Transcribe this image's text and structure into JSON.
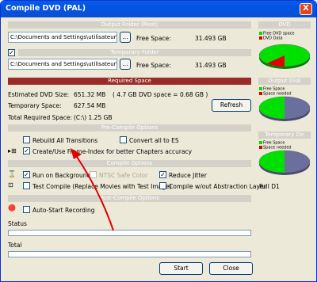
{
  "window": {
    "title": "Compile DVD (PAL)",
    "close_glyph": "X"
  },
  "output_folder": {
    "header": "Output Folder (Root)",
    "path": "C:\\Documents and Settings\\utilisateur\\Bur",
    "browse": "...",
    "free_label": "Free Space:",
    "free_value": "31.493 GB"
  },
  "temp_folder": {
    "header": "Temporary Folder",
    "checked": "✓",
    "path": "C:\\Documents and Settings\\utilisateur\\Bur",
    "browse": "...",
    "free_label": "Free Space:",
    "free_value": "31.493 GB"
  },
  "required": {
    "header": "Required Space",
    "dvd_label": "Estimated DVD Size:",
    "dvd_value": "651.32 MB",
    "dvd_note": "( 4.7 GB DVD space = 0.68 GB )",
    "temp_label": "Temporary Space:",
    "temp_value": "627.54 MB",
    "total_label": "Total Required Space:",
    "total_value": "(C:\\) 1.25 GB",
    "refresh": "Refresh"
  },
  "precompile": {
    "header": "Pre-Compile Options",
    "rebuild": "Rebuild All Transitions",
    "convert": "Convert all to ES",
    "frame_index": "Create/Use Frame-Index for better Chapters accuracy",
    "frame_index_checked": "✓"
  },
  "compile": {
    "header": "Compile Options",
    "background": "Run on Background",
    "background_checked": "✓",
    "ntsc": "NTSC Safe Color",
    "jitter": "Reduce Jitter",
    "jitter_checked": "✓",
    "test": "Test Compile (Replace Movies with Test Image)",
    "abstraction": "Compile w/out Abstraction Layer"
  },
  "postcompile": {
    "header": "Post-Compile Options",
    "autostart": "Auto-Start Recording"
  },
  "status": {
    "status_label": "Status",
    "total_label": "Total"
  },
  "buttons": {
    "start": "Start",
    "close": "Close"
  },
  "dvd_panel": {
    "header": "DVD",
    "legend": [
      "Free DVD space",
      "DVD Data"
    ]
  },
  "output_disk": {
    "header": "Output Disk",
    "legend": [
      "Free Space",
      "Space needed"
    ]
  },
  "temp_dir": {
    "header": "Temporary Dir",
    "legend": [
      "Free Space",
      "Space needed"
    ]
  },
  "quality": "Full D1",
  "colors": {
    "green": "#00e000",
    "red": "#e00000",
    "blue": "#6b6f9e"
  }
}
